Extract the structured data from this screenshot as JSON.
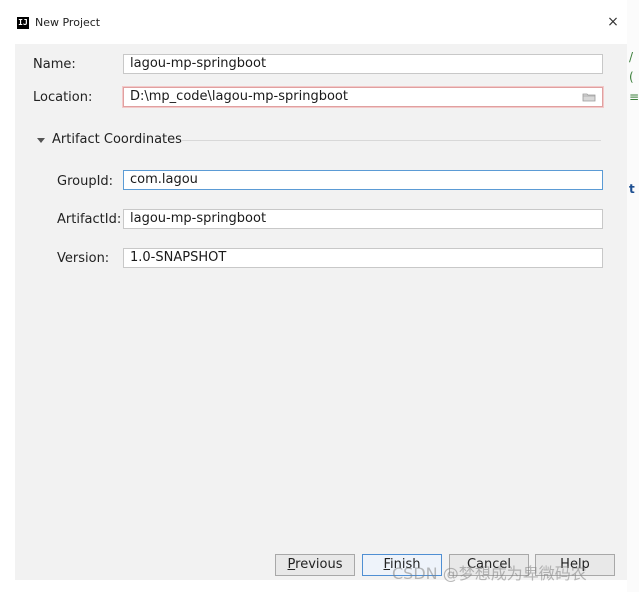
{
  "window": {
    "title": "New Project",
    "app_icon_text": "IJ",
    "close_glyph": "×"
  },
  "form": {
    "name_label": "Name:",
    "name_value": "lagou-mp-springboot",
    "location_label": "Location:",
    "location_value": "D:\\mp_code\\lagou-mp-springboot"
  },
  "artifact": {
    "section_title": "Artifact Coordinates",
    "groupid_label": "GroupId:",
    "groupid_value": "com.lagou",
    "artifactid_label": "ArtifactId:",
    "artifactid_value": "lagou-mp-springboot",
    "version_label": "Version:",
    "version_value": "1.0-SNAPSHOT"
  },
  "buttons": {
    "previous_mnemonic": "P",
    "previous_rest": "revious",
    "finish_mnemonic": "F",
    "finish_rest": "inish",
    "cancel": "Cancel",
    "help": "Help"
  },
  "watermark": "CSDN @梦想成为卑微码农",
  "colors": {
    "focus_border": "#5b9bd5",
    "error_border": "#e0a0a0",
    "dialog_bg": "#f2f2f2"
  }
}
